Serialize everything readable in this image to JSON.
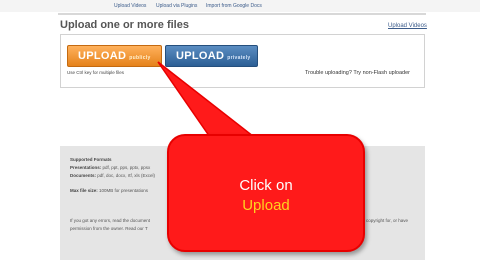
{
  "top_nav": {
    "links": [
      "Upload Videos",
      "Upload via Plugins",
      "Import from Google Docs"
    ]
  },
  "page": {
    "title": "Upload one or more files",
    "upload_videos_link": "Upload Videos"
  },
  "upload_panel": {
    "public_button": {
      "main": "UPLOAD",
      "sub": "publicly"
    },
    "private_button": {
      "main": "UPLOAD",
      "sub": "privately"
    },
    "ctrl_hint": "Use Ctrl key for multiple files",
    "trouble_text": "Trouble uploading? Try non-Flash uploader"
  },
  "info_panel": {
    "supported_formats_heading": "Supported Formats",
    "presentations_label": "Presentations:",
    "presentations_value": "pdf, ppt, pps, pptx, ppsx",
    "documents_label": "Documents:",
    "documents_value": "pdf, doc, docx, rtf, xls (Excel)",
    "max_size_label": "Max file size:",
    "max_size_value": "100MB for presentations",
    "copyright_line": "If you got any errors, read the document",
    "copyright_line2": "permission from the owner. Read our T",
    "right_fragment": "copyright for, or have"
  },
  "callout": {
    "line1": "Click on",
    "line2": "Upload",
    "fill_color": "#ff1a1a",
    "highlight_color": "#ffd21f"
  }
}
